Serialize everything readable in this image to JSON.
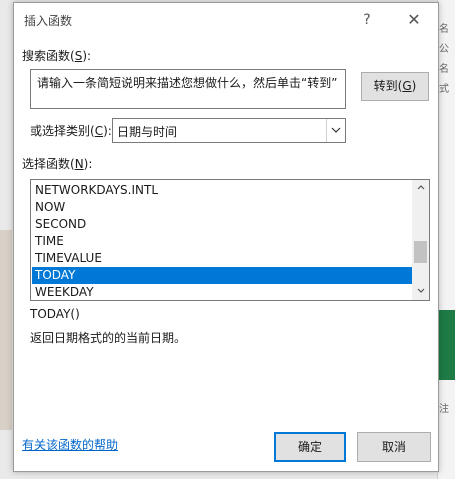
{
  "dialog": {
    "title": "插入函数",
    "help_glyph": "?",
    "close_glyph": "✕"
  },
  "search": {
    "label": "搜索函数(",
    "label_key": "S",
    "label_end": "):",
    "value": "请输入一条简短说明来描述您想做什么，然后单击“转到”",
    "goto_label": "转到(",
    "goto_key": "G",
    "goto_end": ")"
  },
  "category": {
    "label": "或选择类别(",
    "label_key": "C",
    "label_end": "):",
    "selected": "日期与时间"
  },
  "functions": {
    "label": "选择函数(",
    "label_key": "N",
    "label_end": "):",
    "items": [
      {
        "name": "NETWORKDAYS.INTL"
      },
      {
        "name": "NOW"
      },
      {
        "name": "SECOND"
      },
      {
        "name": "TIME"
      },
      {
        "name": "TIMEVALUE"
      },
      {
        "name": "TODAY"
      },
      {
        "name": "WEEKDAY"
      }
    ],
    "selected_index": 5
  },
  "details": {
    "syntax": "TODAY()",
    "description": "返回日期格式的的当前日期。"
  },
  "footer": {
    "help_link": "有关该函数的帮助",
    "ok_label": "确定",
    "cancel_label": "取消"
  },
  "background": {
    "side_chars": [
      "名",
      "公",
      "名",
      "式",
      "注"
    ]
  }
}
